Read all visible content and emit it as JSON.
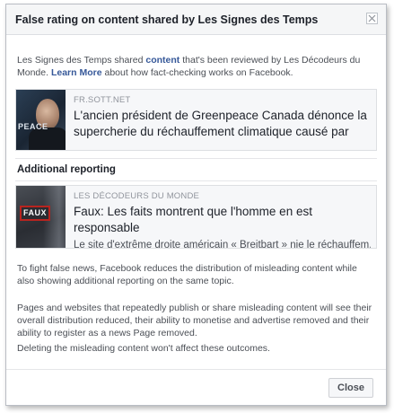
{
  "dialog": {
    "title": "False rating on content shared by Les Signes des Temps",
    "intro_part1": "Les Signes des Temps shared ",
    "intro_link_content": "content",
    "intro_part2": " that's been reviewed by Les Décodeurs du Monde. ",
    "intro_link_learn_more": "Learn More",
    "intro_part3": " about how fact-checking works on Facebook."
  },
  "shared_post": {
    "source": "FR.SOTT.NET",
    "headline": "L'ancien président de Greenpeace Canada dénonce la supercherie du réchauffement climatique causé par",
    "thumb_text": "PEACE"
  },
  "additional_reporting": {
    "title": "Additional reporting",
    "source": "LES DÉCODEURS DU MONDE",
    "headline": "Faux: Les faits montrent que l'homme en est responsable",
    "snippet": "Le site d'extrême droite américain « Breitbart » nie le réchauffem...",
    "thumb_text": "FAUX"
  },
  "info": {
    "paragraph1": "To fight false news, Facebook reduces the distribution of misleading content while also showing additional reporting on the same topic.",
    "paragraph2": "Pages and websites that repeatedly publish or share misleading content will see their overall distribution reduced, their ability to monetise and advertise removed and their ability to register as a news Page removed.",
    "paragraph3": "Deleting the misleading content won't affect these outcomes."
  },
  "footer": {
    "close_label": "Close"
  },
  "colors": {
    "link": "#365899",
    "text": "#1d2129",
    "secondary_text": "#4b4f56",
    "muted_text": "#90949c",
    "header_bg": "#f5f6f7",
    "card_bg": "#f6f7f9",
    "thumb_accent": "#b8241f"
  }
}
